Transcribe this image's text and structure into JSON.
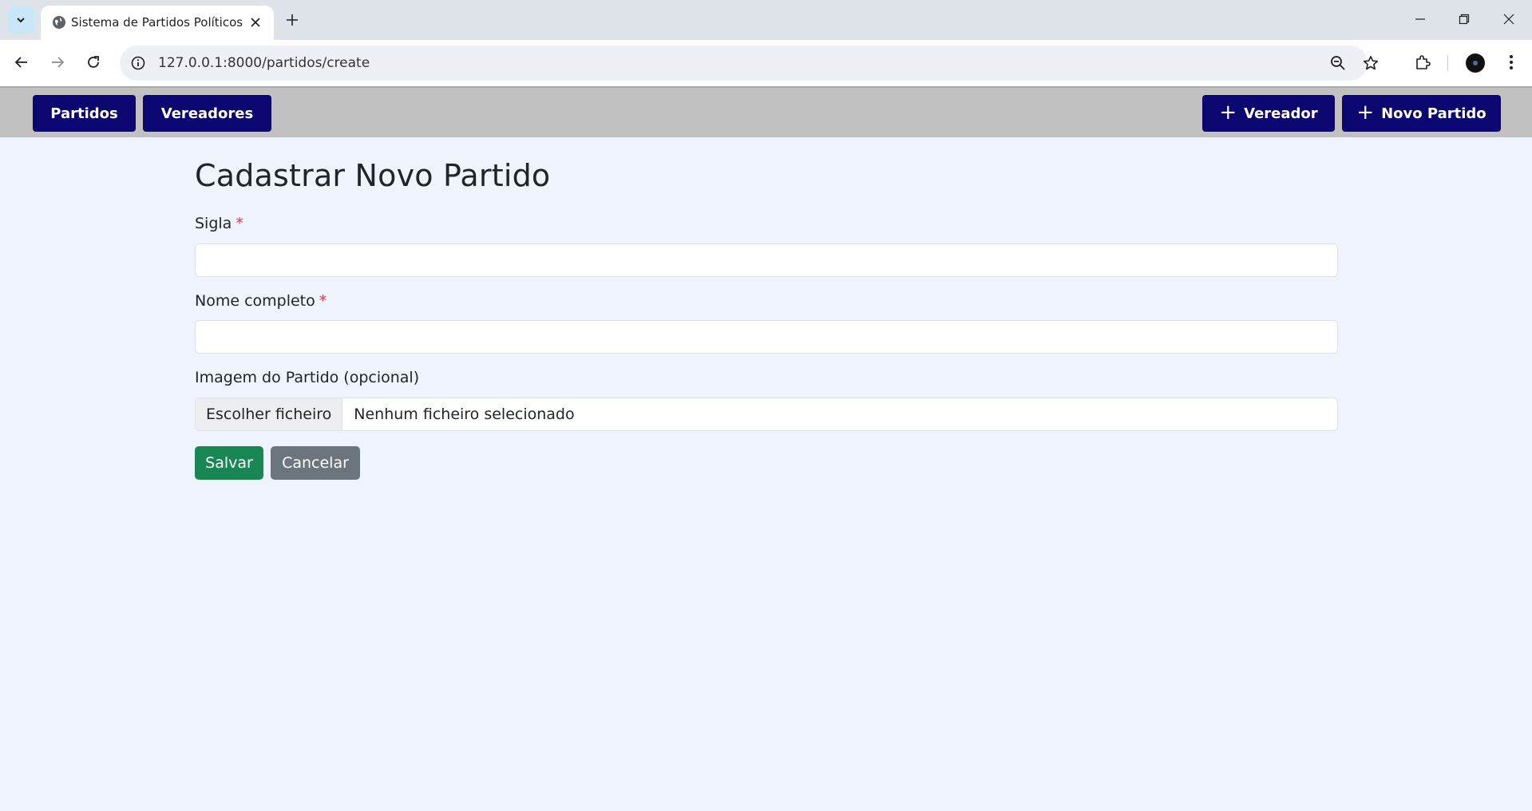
{
  "browser": {
    "tab_title": "Sistema de Partidos Políticos",
    "url": "127.0.0.1:8000/partidos/create",
    "icons": [
      "tab-search-icon",
      "globe-icon",
      "close-icon",
      "plus-icon",
      "minimize-icon",
      "restore-icon",
      "close-window-icon",
      "back-icon",
      "forward-icon",
      "reload-icon",
      "site-info-icon",
      "zoom-icon",
      "star-icon",
      "extensions-icon",
      "profile-avatar",
      "menu-icon"
    ]
  },
  "navbar": {
    "partidos_label": "Partidos",
    "vereadores_label": "Vereadores",
    "add_vereador_label": "Vereador",
    "add_partido_label": "Novo Partido",
    "plus_glyph": "+",
    "colors": {
      "background": "#c1c1c1",
      "button": "#0c0670"
    }
  },
  "form": {
    "title": "Cadastrar Novo Partido",
    "sigla_label": "Sigla",
    "nome_label": "Nome completo",
    "required_mark": "*",
    "imagem_label": "Imagem do Partido (opcional)",
    "file_button_label": "Escolher ficheiro",
    "file_status": "Nenhum ficheiro selecionado",
    "sigla_value": "",
    "nome_value": "",
    "save_label": "Salvar",
    "cancel_label": "Cancelar",
    "colors": {
      "save": "#198754",
      "cancel": "#6c757d",
      "required": "#dc3545",
      "page_background": "#eff3fb"
    }
  }
}
